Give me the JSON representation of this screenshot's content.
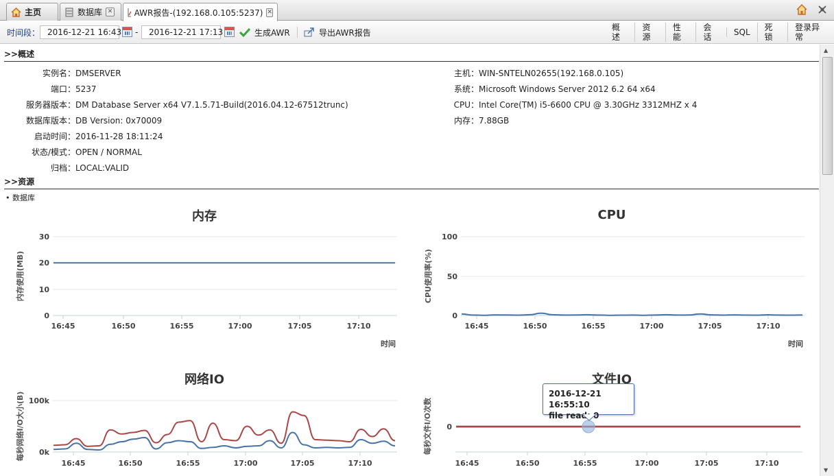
{
  "tabs": [
    {
      "label": "主页",
      "icon": "home-icon",
      "closable": false
    },
    {
      "label": "数据库",
      "icon": "database-icon",
      "closable": true
    },
    {
      "label": "AWR报告-(192.168.0.105:5237)",
      "icon": "chart-icon",
      "closable": true,
      "active": true
    }
  ],
  "toolbar": {
    "period_label": "时间段：",
    "start_time": "2016-12-21 16:43",
    "separator": "-",
    "end_time": "2016-12-21 17:13",
    "generate_label": "生成AWR",
    "export_label": "导出AWR报告",
    "nav": [
      "概述",
      "资源",
      "性能",
      "会话",
      "SQL",
      "死锁",
      "登录异常"
    ]
  },
  "overview": {
    "heading": ">>概述",
    "left": [
      {
        "k": "实例名：",
        "v": "DMSERVER"
      },
      {
        "k": "端口：",
        "v": "5237"
      },
      {
        "k": "服务器版本：",
        "v": "DM Database Server x64 V7.1.5.71-Build(2016.04.12-67512trunc)"
      },
      {
        "k": "数据库版本：",
        "v": "DB Version: 0x70009"
      },
      {
        "k": "启动时间：",
        "v": "2016-11-28 18:11:24"
      },
      {
        "k": "状态/模式：",
        "v": "OPEN / NORMAL"
      },
      {
        "k": "归档：",
        "v": "LOCAL:VALID"
      }
    ],
    "right": [
      {
        "k": "主机：",
        "v": "WIN-SNTELN02655(192.168.0.105)"
      },
      {
        "k": "系统：",
        "v": "Microsoft Windows Server 2012 6.2 64 x64"
      },
      {
        "k": "CPU：",
        "v": "Intel Core(TM) i5-6600 CPU @ 3.30GHz 3312MHZ x 4"
      },
      {
        "k": "内存：",
        "v": "7.88GB"
      }
    ]
  },
  "resources": {
    "heading": ">>资源",
    "bullet": "• 数据库"
  },
  "tooltip": {
    "line1": "2016-12-21 16:55:10",
    "line2": "file read: 0"
  },
  "chart_data": [
    {
      "type": "line",
      "title": "内存",
      "ylabel": "内存使用(MB)",
      "xlabel": "时间",
      "xticks": [
        "16:45",
        "16:50",
        "16:55",
        "17:00",
        "17:05",
        "17:10"
      ],
      "yticks": [
        "0",
        "10",
        "20",
        "30"
      ],
      "ylim": [
        0,
        30
      ],
      "series": [
        {
          "color": "#4572a7",
          "x": [
            0,
            30
          ],
          "y": [
            20,
            20
          ]
        }
      ]
    },
    {
      "type": "line",
      "title": "CPU",
      "ylabel": "CPU使用率(%)",
      "xlabel": "时间",
      "xticks": [
        "16:45",
        "16:50",
        "16:55",
        "17:00",
        "17:05",
        "17:10"
      ],
      "yticks": [
        "0",
        "50",
        "100"
      ],
      "ylim": [
        0,
        100
      ],
      "series": [
        {
          "color": "#4572a7",
          "x": [
            0,
            1,
            2,
            3,
            4,
            5,
            6,
            7,
            8,
            9,
            10,
            11,
            12,
            13,
            14,
            15,
            16,
            17,
            18,
            19,
            20,
            21,
            22,
            23,
            24,
            25,
            26,
            27,
            28,
            29,
            30
          ],
          "y": [
            2,
            0.5,
            0.3,
            0.8,
            0.6,
            0.4,
            1,
            3,
            1,
            0.5,
            0.6,
            1,
            0.5,
            0.3,
            0.4,
            0.5,
            0.3,
            0.5,
            1,
            0.5,
            0.6,
            2,
            0.8,
            0.4,
            0.8,
            0.5,
            0.4,
            0.9,
            0.5,
            0.4,
            0.6
          ]
        }
      ]
    },
    {
      "type": "line",
      "title": "网络IO",
      "ylabel": "每秒网络I/O大小(B)",
      "xlabel": "",
      "xticks": [
        "16:45",
        "16:50",
        "16:55",
        "17:00",
        "17:05",
        "17:10"
      ],
      "yticks": [
        "0k",
        "100k"
      ],
      "ylim": [
        0,
        100000
      ],
      "series": [
        {
          "color": "#aa4643",
          "x": [
            0,
            1,
            2,
            3,
            4,
            5,
            6,
            7,
            8,
            9,
            10,
            11,
            12,
            13,
            14,
            15,
            16,
            17,
            18,
            19,
            20,
            21,
            22,
            23,
            24,
            25,
            26,
            27,
            28,
            29,
            30
          ],
          "y": [
            13000,
            14000,
            26000,
            11000,
            12000,
            43000,
            35000,
            38000,
            42000,
            18000,
            34000,
            58000,
            61000,
            20000,
            56000,
            24000,
            22000,
            50000,
            33000,
            43000,
            17000,
            78000,
            71000,
            24000,
            23000,
            22000,
            20000,
            44000,
            30000,
            45000,
            22000
          ]
        },
        {
          "color": "#4572a7",
          "x": [
            0,
            1,
            2,
            3,
            4,
            5,
            6,
            7,
            8,
            9,
            10,
            11,
            12,
            13,
            14,
            15,
            16,
            17,
            18,
            19,
            20,
            21,
            22,
            23,
            24,
            25,
            26,
            27,
            28,
            29,
            30
          ],
          "y": [
            5000,
            6000,
            17000,
            5000,
            4000,
            15000,
            20000,
            25000,
            28000,
            6000,
            18000,
            22000,
            20000,
            7000,
            9000,
            12000,
            8000,
            11000,
            12000,
            22000,
            8000,
            38000,
            14000,
            8000,
            9000,
            8000,
            9000,
            24000,
            17000,
            21000,
            12000
          ]
        }
      ]
    },
    {
      "type": "line",
      "title": "文件IO",
      "ylabel": "每秒文件I/O次数",
      "xlabel": "",
      "xticks": [
        "16:45",
        "16:50",
        "16:55",
        "17:00",
        "17:05",
        "17:10"
      ],
      "yticks": [
        "0"
      ],
      "ylim": [
        0,
        10
      ],
      "series": [
        {
          "color": "#4572a7",
          "x": [
            0,
            30
          ],
          "y": [
            0,
            0
          ]
        },
        {
          "color": "#aa4643",
          "x": [
            0,
            30
          ],
          "y": [
            0,
            0
          ]
        }
      ]
    }
  ]
}
